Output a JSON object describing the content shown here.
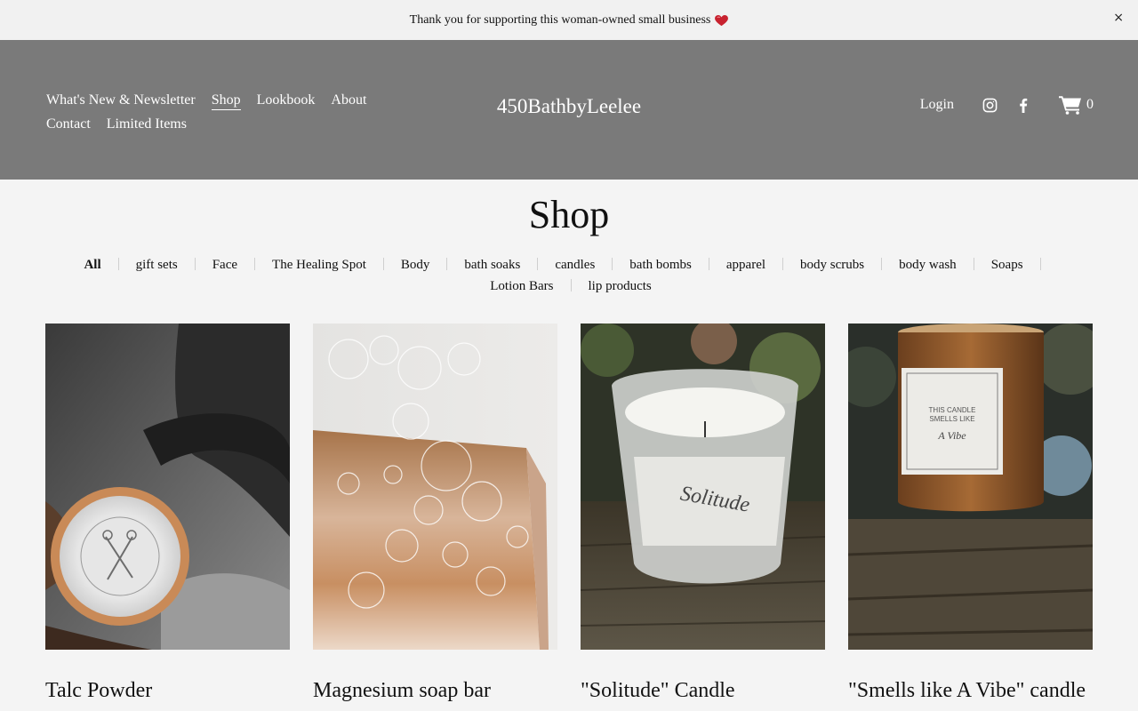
{
  "announcement": {
    "text": "Thank you for supporting this woman-owned small business",
    "close_label": "×"
  },
  "nav": {
    "row1": [
      "What's New & Newsletter",
      "Shop",
      "Lookbook",
      "About"
    ],
    "row2": [
      "Contact",
      "Limited Items"
    ],
    "active": "Shop"
  },
  "brand": "450BathbyLeelee",
  "actions": {
    "login": "Login",
    "cart_count": "0"
  },
  "page_title": "Shop",
  "categories": [
    "All",
    "gift sets",
    "Face",
    "The Healing Spot",
    "Body",
    "bath soaks",
    "candles",
    "bath bombs",
    "apparel",
    "body scrubs",
    "body wash",
    "Soaps",
    "Lotion Bars",
    "lip products"
  ],
  "products": [
    {
      "name": "Talc Powder"
    },
    {
      "name": "Magnesium soap bar"
    },
    {
      "name": "\"Solitude\" Candle"
    },
    {
      "name": "\"Smells like A Vibe\" candle"
    }
  ],
  "colors": {
    "header_bg": "#7a7a7a",
    "page_bg": "#f4f4f4",
    "heart": "#c8222f"
  }
}
